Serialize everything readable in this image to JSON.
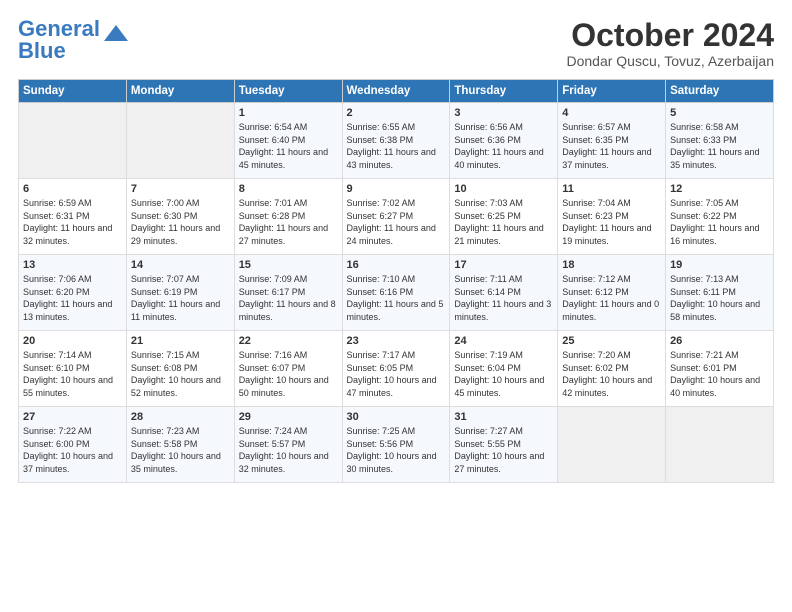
{
  "logo": {
    "line1": "General",
    "line2": "Blue"
  },
  "title": "October 2024",
  "location": "Dondar Quscu, Tovuz, Azerbaijan",
  "days_of_week": [
    "Sunday",
    "Monday",
    "Tuesday",
    "Wednesday",
    "Thursday",
    "Friday",
    "Saturday"
  ],
  "weeks": [
    [
      {
        "day": "",
        "sunrise": "",
        "sunset": "",
        "daylight": ""
      },
      {
        "day": "",
        "sunrise": "",
        "sunset": "",
        "daylight": ""
      },
      {
        "day": "1",
        "sunrise": "Sunrise: 6:54 AM",
        "sunset": "Sunset: 6:40 PM",
        "daylight": "Daylight: 11 hours and 45 minutes."
      },
      {
        "day": "2",
        "sunrise": "Sunrise: 6:55 AM",
        "sunset": "Sunset: 6:38 PM",
        "daylight": "Daylight: 11 hours and 43 minutes."
      },
      {
        "day": "3",
        "sunrise": "Sunrise: 6:56 AM",
        "sunset": "Sunset: 6:36 PM",
        "daylight": "Daylight: 11 hours and 40 minutes."
      },
      {
        "day": "4",
        "sunrise": "Sunrise: 6:57 AM",
        "sunset": "Sunset: 6:35 PM",
        "daylight": "Daylight: 11 hours and 37 minutes."
      },
      {
        "day": "5",
        "sunrise": "Sunrise: 6:58 AM",
        "sunset": "Sunset: 6:33 PM",
        "daylight": "Daylight: 11 hours and 35 minutes."
      }
    ],
    [
      {
        "day": "6",
        "sunrise": "Sunrise: 6:59 AM",
        "sunset": "Sunset: 6:31 PM",
        "daylight": "Daylight: 11 hours and 32 minutes."
      },
      {
        "day": "7",
        "sunrise": "Sunrise: 7:00 AM",
        "sunset": "Sunset: 6:30 PM",
        "daylight": "Daylight: 11 hours and 29 minutes."
      },
      {
        "day": "8",
        "sunrise": "Sunrise: 7:01 AM",
        "sunset": "Sunset: 6:28 PM",
        "daylight": "Daylight: 11 hours and 27 minutes."
      },
      {
        "day": "9",
        "sunrise": "Sunrise: 7:02 AM",
        "sunset": "Sunset: 6:27 PM",
        "daylight": "Daylight: 11 hours and 24 minutes."
      },
      {
        "day": "10",
        "sunrise": "Sunrise: 7:03 AM",
        "sunset": "Sunset: 6:25 PM",
        "daylight": "Daylight: 11 hours and 21 minutes."
      },
      {
        "day": "11",
        "sunrise": "Sunrise: 7:04 AM",
        "sunset": "Sunset: 6:23 PM",
        "daylight": "Daylight: 11 hours and 19 minutes."
      },
      {
        "day": "12",
        "sunrise": "Sunrise: 7:05 AM",
        "sunset": "Sunset: 6:22 PM",
        "daylight": "Daylight: 11 hours and 16 minutes."
      }
    ],
    [
      {
        "day": "13",
        "sunrise": "Sunrise: 7:06 AM",
        "sunset": "Sunset: 6:20 PM",
        "daylight": "Daylight: 11 hours and 13 minutes."
      },
      {
        "day": "14",
        "sunrise": "Sunrise: 7:07 AM",
        "sunset": "Sunset: 6:19 PM",
        "daylight": "Daylight: 11 hours and 11 minutes."
      },
      {
        "day": "15",
        "sunrise": "Sunrise: 7:09 AM",
        "sunset": "Sunset: 6:17 PM",
        "daylight": "Daylight: 11 hours and 8 minutes."
      },
      {
        "day": "16",
        "sunrise": "Sunrise: 7:10 AM",
        "sunset": "Sunset: 6:16 PM",
        "daylight": "Daylight: 11 hours and 5 minutes."
      },
      {
        "day": "17",
        "sunrise": "Sunrise: 7:11 AM",
        "sunset": "Sunset: 6:14 PM",
        "daylight": "Daylight: 11 hours and 3 minutes."
      },
      {
        "day": "18",
        "sunrise": "Sunrise: 7:12 AM",
        "sunset": "Sunset: 6:12 PM",
        "daylight": "Daylight: 11 hours and 0 minutes."
      },
      {
        "day": "19",
        "sunrise": "Sunrise: 7:13 AM",
        "sunset": "Sunset: 6:11 PM",
        "daylight": "Daylight: 10 hours and 58 minutes."
      }
    ],
    [
      {
        "day": "20",
        "sunrise": "Sunrise: 7:14 AM",
        "sunset": "Sunset: 6:10 PM",
        "daylight": "Daylight: 10 hours and 55 minutes."
      },
      {
        "day": "21",
        "sunrise": "Sunrise: 7:15 AM",
        "sunset": "Sunset: 6:08 PM",
        "daylight": "Daylight: 10 hours and 52 minutes."
      },
      {
        "day": "22",
        "sunrise": "Sunrise: 7:16 AM",
        "sunset": "Sunset: 6:07 PM",
        "daylight": "Daylight: 10 hours and 50 minutes."
      },
      {
        "day": "23",
        "sunrise": "Sunrise: 7:17 AM",
        "sunset": "Sunset: 6:05 PM",
        "daylight": "Daylight: 10 hours and 47 minutes."
      },
      {
        "day": "24",
        "sunrise": "Sunrise: 7:19 AM",
        "sunset": "Sunset: 6:04 PM",
        "daylight": "Daylight: 10 hours and 45 minutes."
      },
      {
        "day": "25",
        "sunrise": "Sunrise: 7:20 AM",
        "sunset": "Sunset: 6:02 PM",
        "daylight": "Daylight: 10 hours and 42 minutes."
      },
      {
        "day": "26",
        "sunrise": "Sunrise: 7:21 AM",
        "sunset": "Sunset: 6:01 PM",
        "daylight": "Daylight: 10 hours and 40 minutes."
      }
    ],
    [
      {
        "day": "27",
        "sunrise": "Sunrise: 7:22 AM",
        "sunset": "Sunset: 6:00 PM",
        "daylight": "Daylight: 10 hours and 37 minutes."
      },
      {
        "day": "28",
        "sunrise": "Sunrise: 7:23 AM",
        "sunset": "Sunset: 5:58 PM",
        "daylight": "Daylight: 10 hours and 35 minutes."
      },
      {
        "day": "29",
        "sunrise": "Sunrise: 7:24 AM",
        "sunset": "Sunset: 5:57 PM",
        "daylight": "Daylight: 10 hours and 32 minutes."
      },
      {
        "day": "30",
        "sunrise": "Sunrise: 7:25 AM",
        "sunset": "Sunset: 5:56 PM",
        "daylight": "Daylight: 10 hours and 30 minutes."
      },
      {
        "day": "31",
        "sunrise": "Sunrise: 7:27 AM",
        "sunset": "Sunset: 5:55 PM",
        "daylight": "Daylight: 10 hours and 27 minutes."
      },
      {
        "day": "",
        "sunrise": "",
        "sunset": "",
        "daylight": ""
      },
      {
        "day": "",
        "sunrise": "",
        "sunset": "",
        "daylight": ""
      }
    ]
  ]
}
